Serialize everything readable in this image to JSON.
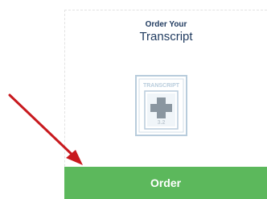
{
  "card": {
    "subtitle": "Order Your",
    "title": "Transcript",
    "icon": {
      "name": "transcript-document-icon",
      "label": "TRANSCRIPT",
      "badge": "3.2"
    },
    "order_button_label": "Order"
  },
  "annotation": {
    "arrow_color": "#c8191e"
  },
  "colors": {
    "button": "#5cb85c",
    "title": "#1f3a5f",
    "icon_stroke": "#b8ccdc"
  }
}
